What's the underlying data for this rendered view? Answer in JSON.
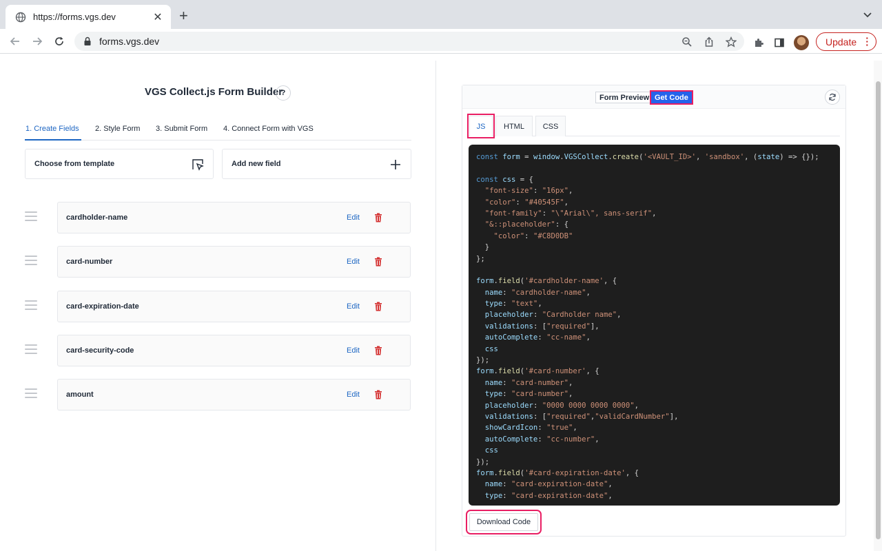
{
  "browser": {
    "tab_title": "https://forms.vgs.dev",
    "url": "forms.vgs.dev",
    "update_label": "Update"
  },
  "builder": {
    "title": "VGS Collect.js Form Builder",
    "help_label": "?",
    "steps": [
      {
        "label": "1. Create Fields",
        "active": true
      },
      {
        "label": "2. Style Form",
        "active": false
      },
      {
        "label": "3. Submit Form",
        "active": false
      },
      {
        "label": "4. Connect Form with VGS",
        "active": false
      }
    ],
    "template_label": "Choose from template",
    "add_field_label": "Add new field",
    "edit_label": "Edit",
    "fields": [
      "cardholder-name",
      "card-number",
      "card-expiration-date",
      "card-security-code",
      "amount"
    ]
  },
  "preview": {
    "form_preview_label": "Form Preview",
    "get_code_label": "Get Code",
    "lang_tabs": [
      "JS",
      "HTML",
      "CSS"
    ],
    "active_lang": "JS",
    "download_label": "Download Code",
    "code_lines": [
      "const form = window.VGSCollect.create('<VAULT_ID>', 'sandbox', (state) => {});",
      "",
      "const css = {",
      "  \"font-size\": \"16px\",",
      "  \"color\": \"#40545F\",",
      "  \"font-family\": \"\\\"Arial\\\", sans-serif\",",
      "  \"&::placeholder\": {",
      "    \"color\": \"#C8D0DB\"",
      "  }",
      "};",
      "",
      "form.field('#cardholder-name', {",
      "  name: \"cardholder-name\",",
      "  type: \"text\",",
      "  placeholder: \"Cardholder name\",",
      "  validations: [\"required\"],",
      "  autoComplete: \"cc-name\",",
      "  css",
      "});",
      "form.field('#card-number', {",
      "  name: \"card-number\",",
      "  type: \"card-number\",",
      "  placeholder: \"0000 0000 0000 0000\",",
      "  validations: [\"required\",\"validCardNumber\"],",
      "  showCardIcon: \"true\",",
      "  autoComplete: \"cc-number\",",
      "  css",
      "});",
      "form.field('#card-expiration-date', {",
      "  name: \"card-expiration-date\",",
      "  type: \"card-expiration-date\","
    ]
  }
}
